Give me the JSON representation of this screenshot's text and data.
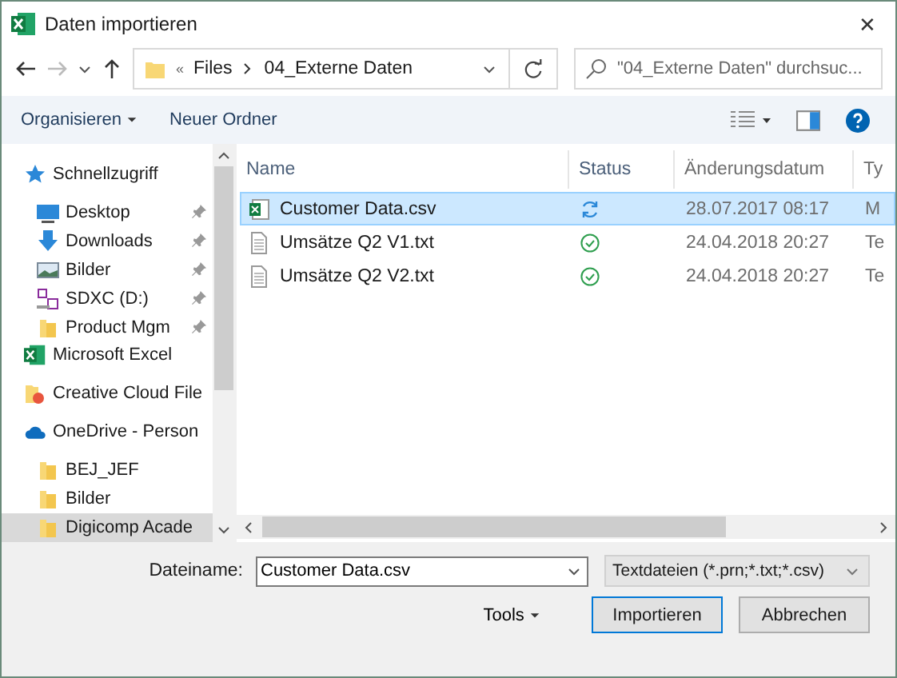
{
  "window": {
    "title": "Daten importieren",
    "close": "✕"
  },
  "address": {
    "overflow": "«",
    "path": [
      "Files",
      "04_Externe Daten"
    ],
    "search_placeholder": "\"04_Externe Daten\" durchsuc..."
  },
  "toolbar": {
    "organize": "Organisieren",
    "new_folder": "Neuer Ordner"
  },
  "sidebar": {
    "items": [
      {
        "label": "Schnellzugriff",
        "kind": "star",
        "selected": false,
        "children": [
          {
            "label": "Desktop",
            "kind": "desktop",
            "pinned": true,
            "selected": false
          },
          {
            "label": "Downloads",
            "kind": "download",
            "pinned": true,
            "selected": false
          },
          {
            "label": "Bilder",
            "kind": "pictures",
            "pinned": true,
            "selected": false
          },
          {
            "label": "SDXC (D:)",
            "kind": "sd",
            "pinned": true,
            "selected": false
          },
          {
            "label": "Product Mgm",
            "kind": "folder",
            "pinned": true,
            "selected": false
          }
        ]
      },
      {
        "label": "Microsoft Excel",
        "kind": "excel",
        "selected": false
      },
      {
        "label": "Creative Cloud File",
        "kind": "cc",
        "selected": false
      },
      {
        "label": "OneDrive - Person",
        "kind": "cloud",
        "selected": false,
        "children": [
          {
            "label": "BEJ_JEF",
            "kind": "folder",
            "pinned": false,
            "selected": false
          },
          {
            "label": "Bilder",
            "kind": "folder",
            "pinned": false,
            "selected": false
          },
          {
            "label": "Digicomp Acade",
            "kind": "folder",
            "pinned": false,
            "selected": true
          }
        ]
      }
    ]
  },
  "table": {
    "columns": [
      "Name",
      "Status",
      "Änderungsdatum",
      "Ty"
    ],
    "rows": [
      {
        "name": "Customer Data.csv",
        "kind": "excel",
        "status": {
          "kind": "sync"
        },
        "date": "28.07.2017 08:17",
        "column_4": "M",
        "selected": true
      },
      {
        "name": "Umsätze Q2 V1.txt",
        "kind": "text",
        "status": {
          "kind": "ok"
        },
        "date": "24.04.2018 20:27",
        "column_4": "Te",
        "selected": false
      },
      {
        "name": "Umsätze Q2 V2.txt",
        "kind": "text",
        "status": {
          "kind": "ok"
        },
        "date": "24.04.2018 20:27",
        "column_4": "Te",
        "selected": false
      }
    ]
  },
  "footer": {
    "filename_label": "Dateiname:",
    "filename": "Customer Data.csv",
    "filter": "Textdateien (*.prn;*.txt;*.csv)",
    "tools": "Tools",
    "import": "Importieren",
    "cancel": "Abbrechen"
  }
}
